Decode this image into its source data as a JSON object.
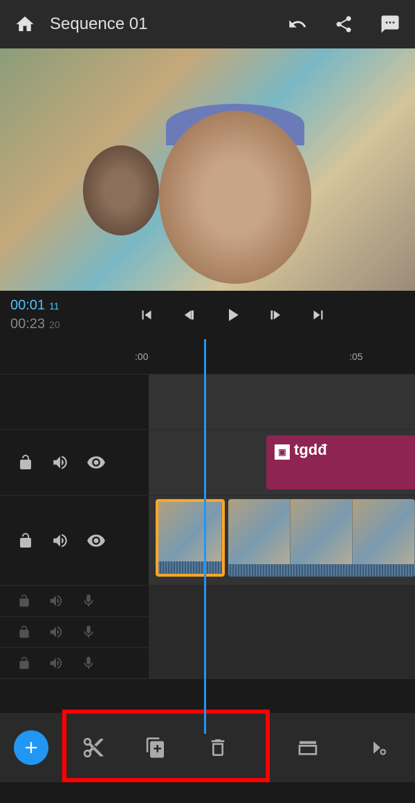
{
  "header": {
    "title": "Sequence 01"
  },
  "timecode": {
    "current_time": "00:01",
    "current_frames": "11",
    "total_time": "00:23",
    "total_frames": "20"
  },
  "ruler": {
    "tick_00": ":00",
    "tick_05": ":05"
  },
  "tracks": {
    "text_clip_label": "tgdđ"
  }
}
